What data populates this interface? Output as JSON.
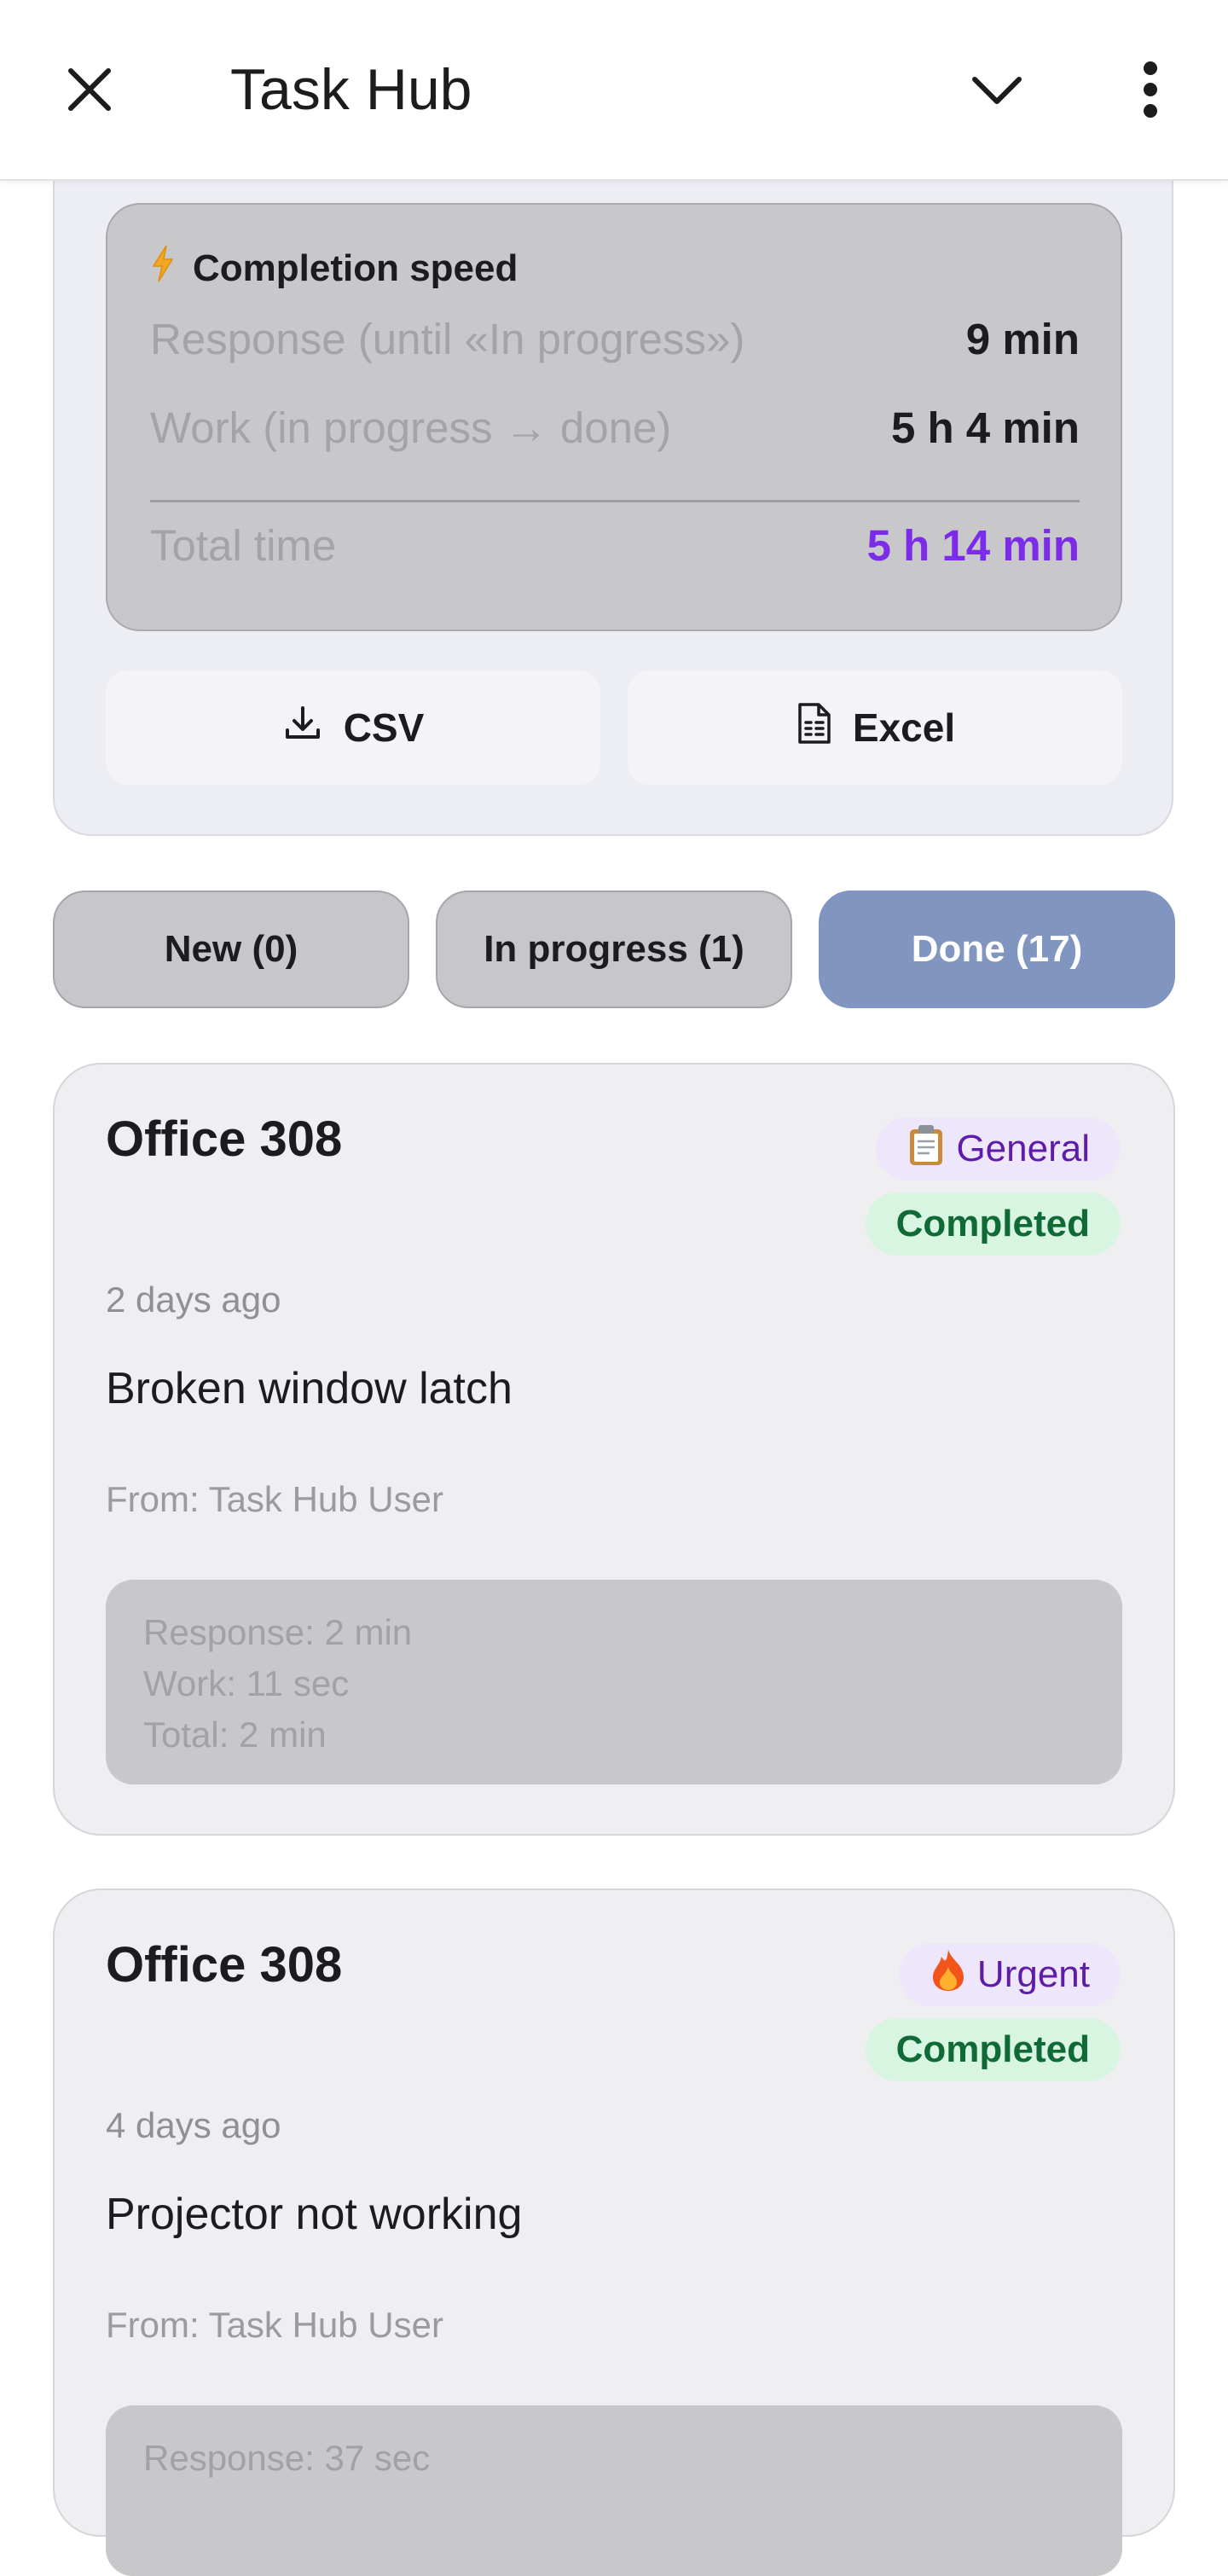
{
  "app": {
    "title": "Task Hub"
  },
  "stats": {
    "speed_title": "Completion speed",
    "rows": [
      {
        "label": "Response (until «In progress»)",
        "value": "9 min"
      },
      {
        "label": "Work (in progress → done)",
        "value": "5 h 4 min"
      }
    ],
    "total": {
      "label": "Total time",
      "value": "5 h 14 min"
    },
    "export": {
      "csv": "CSV",
      "excel": "Excel"
    }
  },
  "filters": [
    {
      "label": "New (0)",
      "active": false
    },
    {
      "label": "In progress (1)",
      "active": false
    },
    {
      "label": "Done (17)",
      "active": true
    }
  ],
  "tasks": [
    {
      "title": "Office 308",
      "category": "General",
      "category_icon": "clipboard-icon",
      "status": "Completed",
      "time": "2 days ago",
      "description": "Broken window latch",
      "from": "From: Task Hub User",
      "timing": [
        "Response: 2 min",
        "Work: 11 sec",
        "Total: 2 min"
      ]
    },
    {
      "title": "Office 308",
      "category": "Urgent",
      "category_icon": "fire-icon",
      "status": "Completed",
      "time": "4 days ago",
      "description": "Projector not working",
      "from": "From: Task Hub User",
      "timing": [
        "Response: 37 sec"
      ]
    }
  ],
  "colors": {
    "accent_purple": "#7c2ce8",
    "active_chip": "#8095bf",
    "completed_green": "#0f6a36"
  }
}
